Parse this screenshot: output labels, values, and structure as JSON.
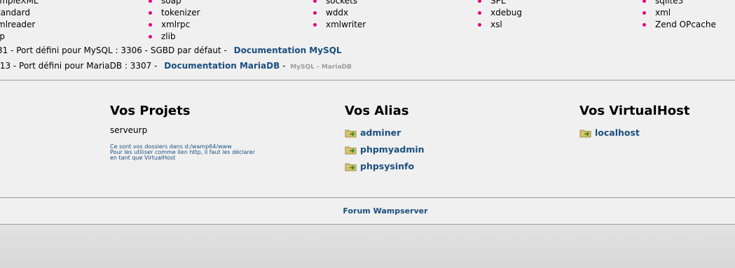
{
  "extensions": {
    "col0": [
      "impleXML",
      "tandard",
      "mlreader",
      "ip"
    ],
    "col1": [
      "soap",
      "tokenizer",
      "xmlrpc",
      "zlib"
    ],
    "col2": [
      "sockets",
      "wddx",
      "xmlwriter"
    ],
    "col3": [
      "SPL",
      "xdebug",
      "xsl"
    ],
    "col4": [
      "sqlite3",
      "xml",
      "Zend OPcache"
    ]
  },
  "databases": {
    "mysql": {
      "text": "31 - Port défini pour MySQL : 3306 - SGBD par défaut - ",
      "link": "Documentation MySQL"
    },
    "mariadb": {
      "text": ".13 - Port défini pour MariaDB : 3307 - ",
      "link": "Documentation MariaDB",
      "separator": "-",
      "note": "MySQL - MariaDB"
    }
  },
  "projects": {
    "title": "Vos Projets",
    "items": [
      "serveurp"
    ],
    "note_line1": "Ce sont vos dossiers dans d:/wamp64/www",
    "note_line2": "Pour les utiliser comme lien http, il faut les déclarer",
    "note_line3": "en tant que VirtualHost"
  },
  "aliases": {
    "title": "Vos Alias",
    "items": [
      "adminer",
      "phpmyadmin",
      "phpsysinfo"
    ]
  },
  "virtualhosts": {
    "title": "Vos VirtualHost",
    "items": [
      "localhost"
    ]
  },
  "footer": {
    "forum_link": "Forum Wampserver"
  },
  "colors": {
    "link": "#1b4e7e",
    "bullet": "#e3007d",
    "background": "#f0f0f0"
  }
}
